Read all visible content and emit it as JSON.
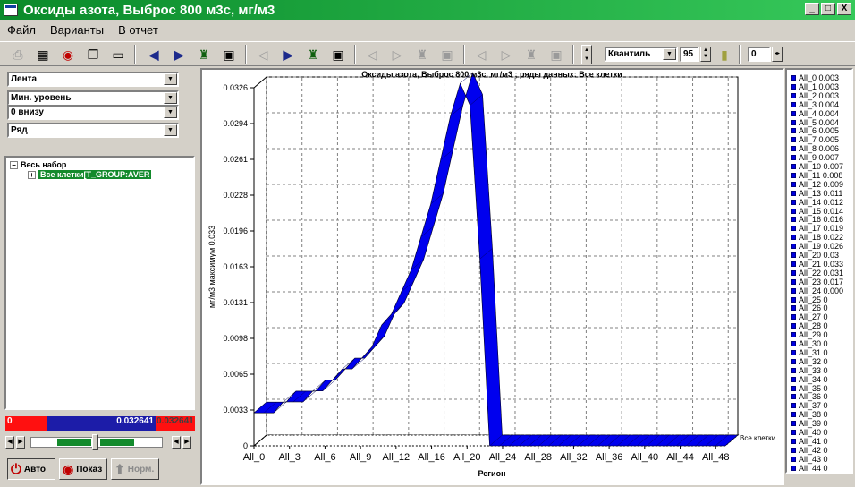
{
  "window": {
    "title": "Оксиды азота, Выброс 800 м3с,  мг/м3",
    "buttons": [
      "_",
      "□",
      "X"
    ]
  },
  "menu": [
    "Файл",
    "Варианты",
    "В отчет"
  ],
  "toolbar": {
    "icons": [
      "print-icon",
      "table-icon",
      "record-icon",
      "copy-icon",
      "open-icon",
      "prev-icon",
      "next-icon",
      "marker-icon",
      "play-icon"
    ],
    "palette_combo": "Квантиль",
    "palette_value": "95",
    "right_value": "0"
  },
  "left_panel": {
    "combos": [
      "Лента",
      "Мин. уровень",
      "0 внизу",
      "Ряд"
    ],
    "tree": {
      "root": "Весь набор",
      "child": "Все клетки[T_GROUP:AVER"
    },
    "scale": {
      "min": "0",
      "max": "0.032641",
      "max2": "0.032641"
    },
    "buttons": {
      "auto": "Авто",
      "show": "Показ",
      "norm": "Норм."
    }
  },
  "colors": {
    "series": "#0000ee",
    "title_bar": "#0a8a2a",
    "scale_red": "#ff1010",
    "scale_blue": "#1c1ca8"
  },
  "chart_data": {
    "type": "area",
    "title": "Оксиды азота, Выброс 800 м3с,  мг/м3 ; ряды данных: Все клетки",
    "xlabel": "Регион",
    "ylabel": "мг/м3  максимум 0.033",
    "series_label": "Все клетки",
    "yticks": [
      "0",
      "0.0033",
      "0.0065",
      "0.0098",
      "0.0131",
      "0.0163",
      "0.0196",
      "0.0228",
      "0.0261",
      "0.0294",
      "0.0326"
    ],
    "xticks": [
      "All_0",
      "All_3",
      "All_6",
      "All_9",
      "All_12",
      "All_16",
      "All_20",
      "All_24",
      "All_28",
      "All_32",
      "All_36",
      "All_40",
      "All_44",
      "All_48"
    ],
    "ylim": [
      0,
      0.0326
    ],
    "series": [
      {
        "values": [
          0.003,
          0.003,
          0.003,
          0.004,
          0.004,
          0.004,
          0.005,
          0.005,
          0.006,
          0.007,
          0.007,
          0.008,
          0.009,
          0.011,
          0.012,
          0.014,
          0.016,
          0.019,
          0.022,
          0.026,
          0.03,
          0.033,
          0.031,
          0.017,
          0.0,
          0,
          0,
          0,
          0,
          0,
          0,
          0,
          0,
          0,
          0,
          0,
          0,
          0,
          0,
          0,
          0,
          0,
          0,
          0,
          0,
          0,
          0,
          0,
          0
        ]
      }
    ]
  },
  "legend_items": [
    "All_0 0.003",
    "All_1 0.003",
    "All_2 0.003",
    "All_3 0.004",
    "All_4 0.004",
    "All_5 0.004",
    "All_6 0.005",
    "All_7 0.005",
    "All_8 0.006",
    "All_9 0.007",
    "All_10 0.007",
    "All_11 0.008",
    "All_12 0.009",
    "All_13 0.011",
    "All_14 0.012",
    "All_15 0.014",
    "All_16 0.016",
    "All_17 0.019",
    "All_18 0.022",
    "All_19 0.026",
    "All_20 0.03",
    "All_21 0.033",
    "All_22 0.031",
    "All_23 0.017",
    "All_24 0.000",
    "All_25 0",
    "All_26 0",
    "All_27 0",
    "All_28 0",
    "All_29 0",
    "All_30 0",
    "All_31 0",
    "All_32 0",
    "All_33 0",
    "All_34 0",
    "All_35 0",
    "All_36 0",
    "All_37 0",
    "All_38 0",
    "All_39 0",
    "All_40 0",
    "All_41 0",
    "All_42 0",
    "All_43 0",
    "All_44 0"
  ]
}
